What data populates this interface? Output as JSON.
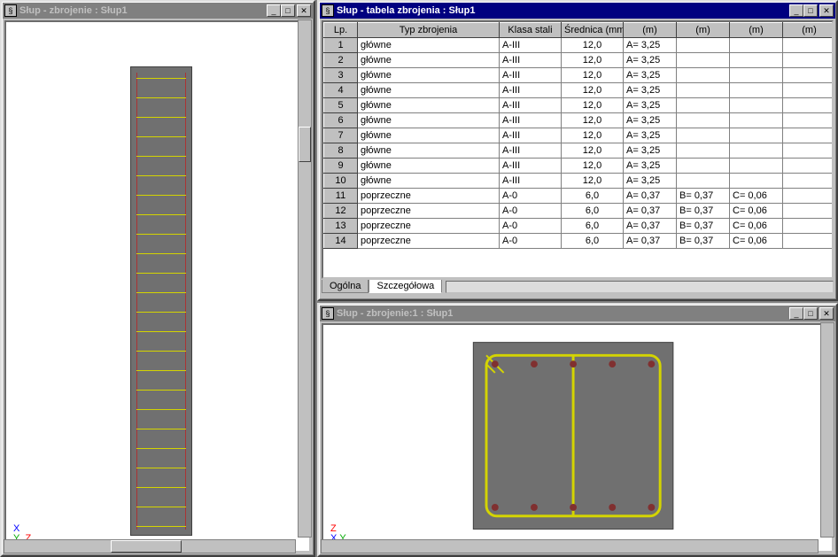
{
  "windows": {
    "left": {
      "title": "Słup - zbrojenie : Słup1"
    },
    "table": {
      "title": "Słup - tabela zbrojenia : Słup1"
    },
    "section": {
      "title": "Słup - zbrojenie:1 : Słup1"
    }
  },
  "axis_left": {
    "x": "X",
    "y": "Y",
    "z": "Z"
  },
  "axis_section": {
    "x": "X",
    "y": "Y",
    "z": "Z"
  },
  "tabs": {
    "ogolna": "Ogólna",
    "szczegolowa": "Szczegółowa"
  },
  "headers": {
    "lp": "Lp.",
    "typ": "Typ zbrojenia",
    "klasa": "Klasa stali",
    "srednica": "Średnica (mm)",
    "m1": "(m)",
    "m2": "(m)",
    "m3": "(m)",
    "m4": "(m)"
  },
  "rows": [
    {
      "lp": "1",
      "typ": "główne",
      "kl": "A-III",
      "sr": "12,0",
      "a": "A= 3,25",
      "b": "",
      "c": "",
      "d": ""
    },
    {
      "lp": "2",
      "typ": "główne",
      "kl": "A-III",
      "sr": "12,0",
      "a": "A= 3,25",
      "b": "",
      "c": "",
      "d": ""
    },
    {
      "lp": "3",
      "typ": "główne",
      "kl": "A-III",
      "sr": "12,0",
      "a": "A= 3,25",
      "b": "",
      "c": "",
      "d": ""
    },
    {
      "lp": "4",
      "typ": "główne",
      "kl": "A-III",
      "sr": "12,0",
      "a": "A= 3,25",
      "b": "",
      "c": "",
      "d": ""
    },
    {
      "lp": "5",
      "typ": "główne",
      "kl": "A-III",
      "sr": "12,0",
      "a": "A= 3,25",
      "b": "",
      "c": "",
      "d": ""
    },
    {
      "lp": "6",
      "typ": "główne",
      "kl": "A-III",
      "sr": "12,0",
      "a": "A= 3,25",
      "b": "",
      "c": "",
      "d": ""
    },
    {
      "lp": "7",
      "typ": "główne",
      "kl": "A-III",
      "sr": "12,0",
      "a": "A= 3,25",
      "b": "",
      "c": "",
      "d": ""
    },
    {
      "lp": "8",
      "typ": "główne",
      "kl": "A-III",
      "sr": "12,0",
      "a": "A= 3,25",
      "b": "",
      "c": "",
      "d": ""
    },
    {
      "lp": "9",
      "typ": "główne",
      "kl": "A-III",
      "sr": "12,0",
      "a": "A= 3,25",
      "b": "",
      "c": "",
      "d": ""
    },
    {
      "lp": "10",
      "typ": "główne",
      "kl": "A-III",
      "sr": "12,0",
      "a": "A= 3,25",
      "b": "",
      "c": "",
      "d": ""
    },
    {
      "lp": "11",
      "typ": "poprzeczne",
      "kl": "A-0",
      "sr": "6,0",
      "a": "A= 0,37",
      "b": "B= 0,37",
      "c": "C= 0,06",
      "d": ""
    },
    {
      "lp": "12",
      "typ": "poprzeczne",
      "kl": "A-0",
      "sr": "6,0",
      "a": "A= 0,37",
      "b": "B= 0,37",
      "c": "C= 0,06",
      "d": ""
    },
    {
      "lp": "13",
      "typ": "poprzeczne",
      "kl": "A-0",
      "sr": "6,0",
      "a": "A= 0,37",
      "b": "B= 0,37",
      "c": "C= 0,06",
      "d": ""
    },
    {
      "lp": "14",
      "typ": "poprzeczne",
      "kl": "A-0",
      "sr": "6,0",
      "a": "A= 0,37",
      "b": "B= 0,37",
      "c": "C= 0,06",
      "d": ""
    }
  ]
}
